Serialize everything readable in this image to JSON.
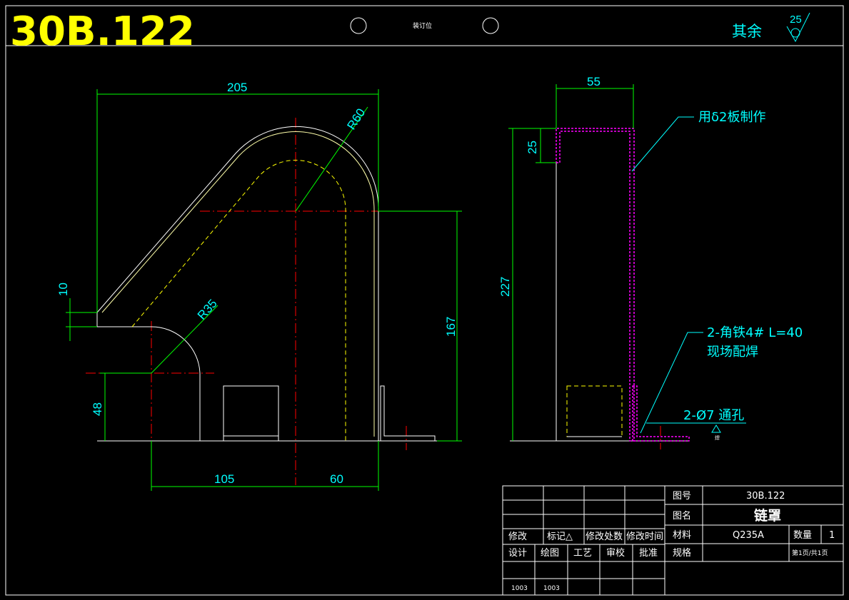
{
  "header": {
    "drawing_number": "30B.122",
    "binding_label": "装订位",
    "rest_label": "其余",
    "roughness_value": "25"
  },
  "front_view": {
    "dims": {
      "width_total": "205",
      "bend_radius": "R60",
      "lower_radius": "R35",
      "left_step": "10",
      "height_right": "167",
      "base_height": "48",
      "bottom_left": "105",
      "bottom_right": "60"
    }
  },
  "side_view": {
    "dims": {
      "depth": "55",
      "top_lip": "25",
      "total_height": "227"
    },
    "notes": {
      "plate": "用δ2板制作",
      "angle_line1": "2-角铁4# L=40",
      "angle_line2": "现场配焊",
      "hole": "2-Ø7 通孔",
      "weld_symbol": "焊"
    }
  },
  "title_block": {
    "labels": {
      "drawing_no_label": "图号",
      "name_label": "图名",
      "material_label": "材料",
      "quantity_label": "数量",
      "spec_label": "规格"
    },
    "values": {
      "drawing_no": "30B.122",
      "name": "链罩",
      "material": "Q235A",
      "quantity": "1",
      "page": "第1页/共1页"
    },
    "revision_headers": [
      "修改",
      "标记△",
      "修改处数",
      "修改时间"
    ],
    "sign_headers": [
      "设计",
      "绘图",
      "工艺",
      "审校",
      "批准"
    ],
    "codes": [
      "1003",
      "1003"
    ]
  }
}
